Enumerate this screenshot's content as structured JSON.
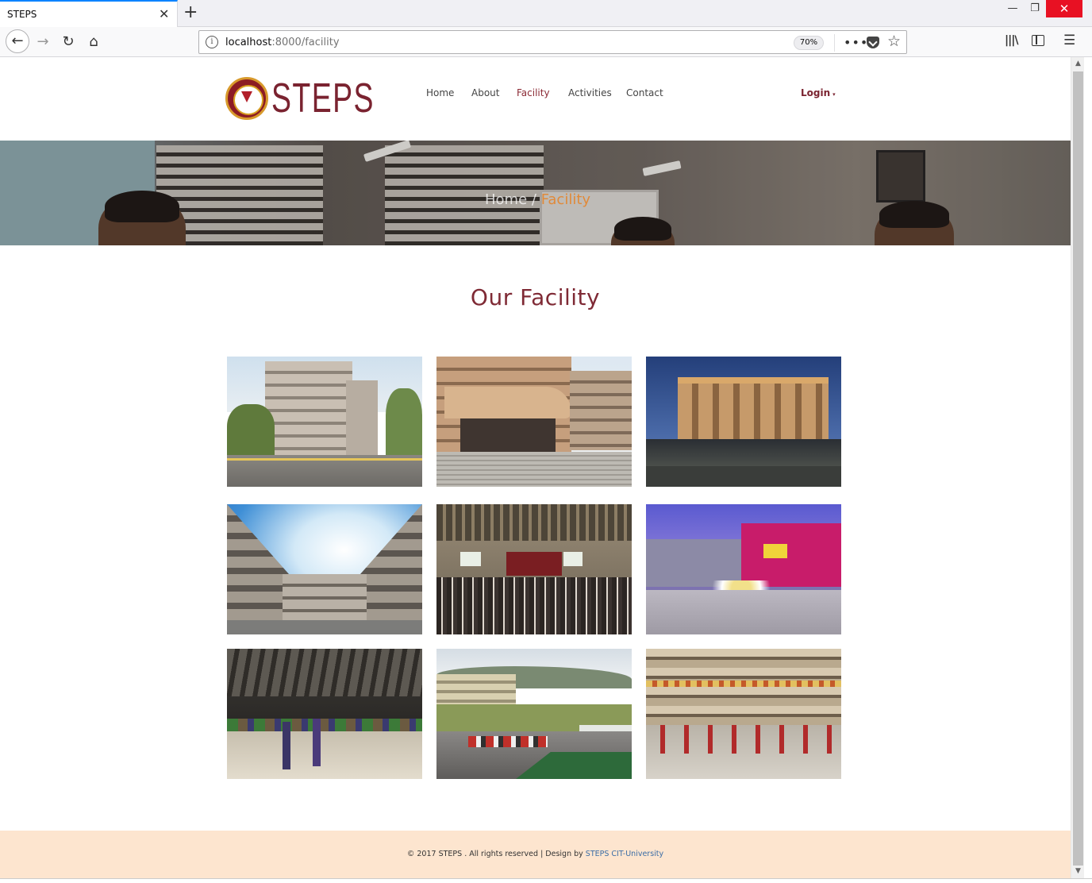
{
  "browser": {
    "tab_title": "STEPS",
    "url_host": "localhost",
    "url_path": ":8000/facility",
    "zoom": "70%"
  },
  "site": {
    "logo_text": "STEPS",
    "nav": [
      "Home",
      "About",
      "Facility",
      "Activities",
      "Contact"
    ],
    "active_nav": "Facility",
    "login_label": "Login"
  },
  "hero": {
    "breadcrumb_home": "Home",
    "breadcrumb_sep": "/",
    "breadcrumb_current": "Facility"
  },
  "section_title": "Our Facility",
  "gallery": [
    {
      "label": "campus-street"
    },
    {
      "label": "building-entrance"
    },
    {
      "label": "building-night"
    },
    {
      "label": "courtyard-sky"
    },
    {
      "label": "gymnasium-assembly"
    },
    {
      "label": "stage-event"
    },
    {
      "label": "volleyball-court"
    },
    {
      "label": "campus-field"
    },
    {
      "label": "courtyard-performance"
    }
  ],
  "footer": {
    "text": "© 2017 STEPS . All rights reserved | Design by ",
    "link": "STEPS CIT-University"
  },
  "colors": {
    "brand": "#7a2330",
    "active_nav": "#8b2a35",
    "breadcrumb_current": "#e08a3a",
    "footer_bg": "#fde5cf",
    "footer_link": "#3b6da6"
  },
  "icons": [
    "back-icon",
    "forward-icon",
    "reload-icon",
    "home-icon",
    "info-icon",
    "page-actions-icon",
    "pocket-icon",
    "bookmark-star-icon",
    "library-icon",
    "sidebar-icon",
    "menu-icon",
    "close-icon",
    "new-tab-icon"
  ]
}
